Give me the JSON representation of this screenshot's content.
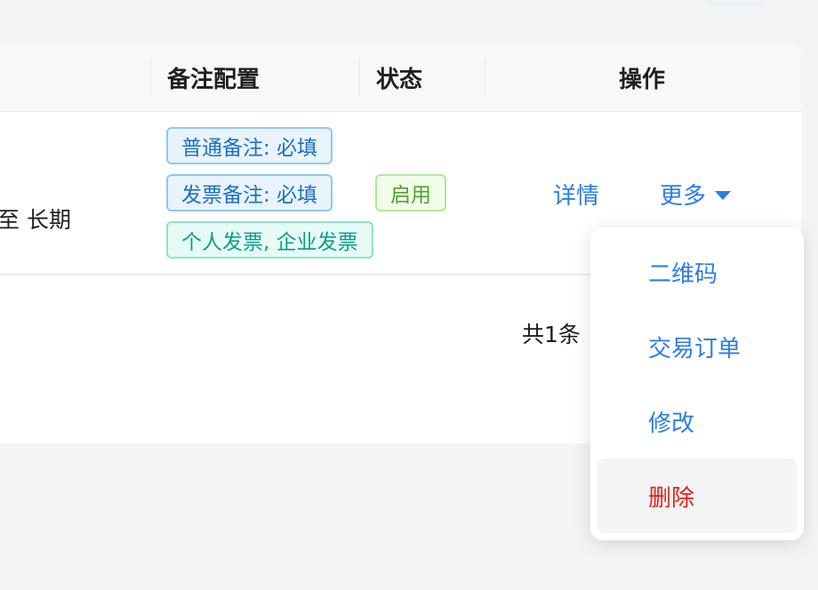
{
  "table": {
    "headers": {
      "remark_config": "备注配置",
      "status": "状态",
      "actions": "操作"
    },
    "rows": [
      {
        "validity": "至 长期",
        "remark_tags": [
          "普通备注: 必填",
          "发票备注: 必填",
          "个人发票, 企业发票"
        ],
        "status": "启用",
        "detail_label": "详情",
        "more_label": "更多"
      }
    ]
  },
  "pagination": {
    "total_text": "共1条"
  },
  "more_menu": {
    "items": [
      {
        "label": "二维码"
      },
      {
        "label": "交易订单"
      },
      {
        "label": "修改"
      },
      {
        "label": "删除",
        "danger": true
      }
    ]
  },
  "colors": {
    "link": "#2b7de9",
    "danger": "#e2231a",
    "tag_blue": "#1e6fc0",
    "tag_teal": "#0f9e85",
    "tag_green": "#4da52a"
  }
}
